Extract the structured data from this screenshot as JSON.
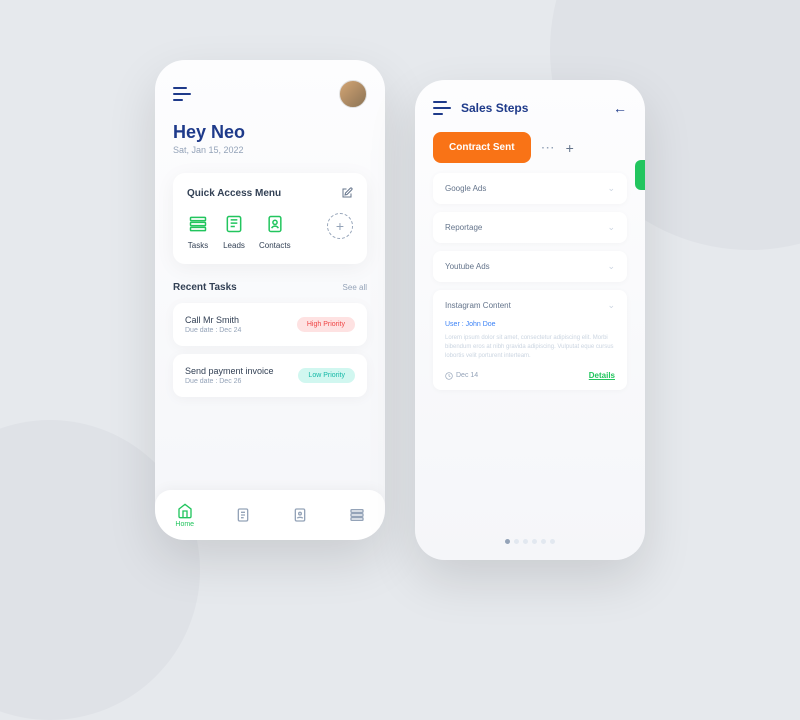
{
  "home": {
    "greeting": "Hey Neo",
    "date": "Sat, Jan 15, 2022",
    "quick_access": {
      "title": "Quick Access Menu",
      "items": [
        {
          "label": "Tasks"
        },
        {
          "label": "Leads"
        },
        {
          "label": "Contacts"
        }
      ]
    },
    "recent_tasks": {
      "title": "Recent Tasks",
      "see_all": "See all",
      "tasks": [
        {
          "title": "Call Mr Smith",
          "due": "Due date : Dec 24",
          "priority": "High Priority"
        },
        {
          "title": "Send payment invoice",
          "due": "Due date : Dec 26",
          "priority": "Low Priority"
        }
      ]
    },
    "nav": {
      "home": "Home"
    }
  },
  "sales": {
    "title": "Sales Steps",
    "contract_button": "Contract Sent",
    "items": [
      {
        "title": "Google Ads"
      },
      {
        "title": "Reportage"
      },
      {
        "title": "Youtube Ads"
      },
      {
        "title": "Instagram Content",
        "user": "User : John Doe",
        "text": "Lorem ipsum dolor sit amet, consectetur adipiscing elit. Morbi bibendum eros at nibh gravida adipiscing. Vulputat eque cursus lobortis velit porturent interteam.",
        "date": "Dec 14",
        "details": "Details"
      }
    ]
  }
}
